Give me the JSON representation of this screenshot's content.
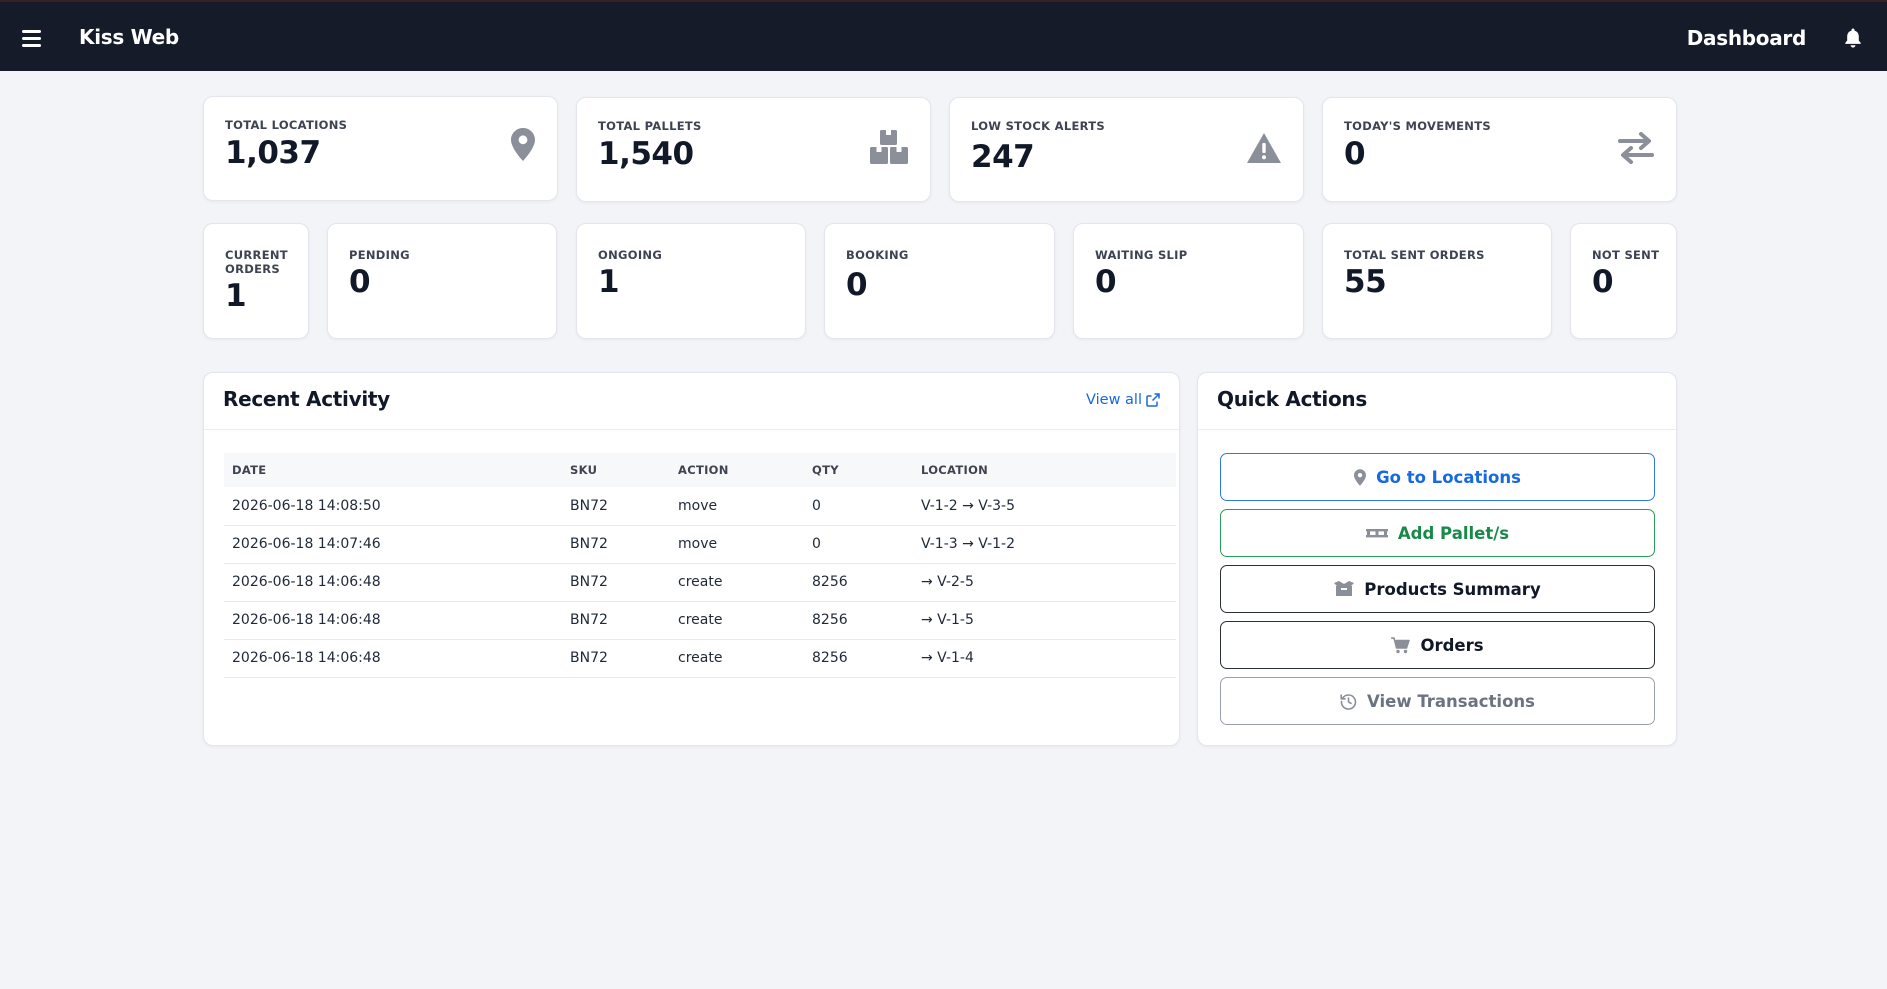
{
  "app": {
    "brand": "Kiss Web",
    "page_title": "Dashboard"
  },
  "stats_top": [
    {
      "label": "TOTAL LOCATIONS",
      "value": "1,037",
      "icon": "map-pin-icon"
    },
    {
      "label": "TOTAL PALLETS",
      "value": "1,540",
      "icon": "boxes-icon"
    },
    {
      "label": "LOW STOCK ALERTS",
      "value": "247",
      "icon": "warning-icon"
    },
    {
      "label": "TODAY'S MOVEMENTS",
      "value": "0",
      "icon": "exchange-icon"
    }
  ],
  "stats_orders": [
    {
      "label": "CURRENT ORDERS",
      "value": "1"
    },
    {
      "label": "PENDING",
      "value": "0"
    },
    {
      "label": "ONGOING",
      "value": "1"
    },
    {
      "label": "BOOKING",
      "value": "0"
    },
    {
      "label": "WAITING SLIP",
      "value": "0"
    },
    {
      "label": "TOTAL SENT ORDERS",
      "value": "55"
    },
    {
      "label": "NOT SENT",
      "value": "0"
    }
  ],
  "recent_activity": {
    "title": "Recent Activity",
    "view_all": "View all",
    "columns": [
      "DATE",
      "SKU",
      "ACTION",
      "QTY",
      "LOCATION"
    ],
    "rows": [
      [
        "2026-06-18 14:08:50",
        "BN72",
        "move",
        "0",
        "V-1-2 → V-3-5"
      ],
      [
        "2026-06-18 14:07:46",
        "BN72",
        "move",
        "0",
        "V-1-3 → V-1-2"
      ],
      [
        "2026-06-18 14:06:48",
        "BN72",
        "create",
        "8256",
        "→ V-2-5"
      ],
      [
        "2026-06-18 14:06:48",
        "BN72",
        "create",
        "8256",
        "→ V-1-5"
      ],
      [
        "2026-06-18 14:06:48",
        "BN72",
        "create",
        "8256",
        "→ V-1-4"
      ]
    ]
  },
  "quick_actions": {
    "title": "Quick Actions",
    "buttons": [
      {
        "label": "Go to Locations",
        "icon": "map-pin-icon",
        "color": "#1769e0"
      },
      {
        "label": "Add Pallet/s",
        "icon": "pallet-icon",
        "color": "#178a4a"
      },
      {
        "label": "Products Summary",
        "icon": "box-open-icon",
        "color": "#111827"
      },
      {
        "label": "Orders",
        "icon": "cart-icon",
        "color": "#111827"
      },
      {
        "label": "View Transactions",
        "icon": "history-icon",
        "color": "#6b7280"
      }
    ]
  },
  "colors": {
    "topbar": "#161b29",
    "background": "#f3f4f8",
    "link": "#1769e0",
    "success": "#178a4a",
    "muted": "#6b7280"
  }
}
